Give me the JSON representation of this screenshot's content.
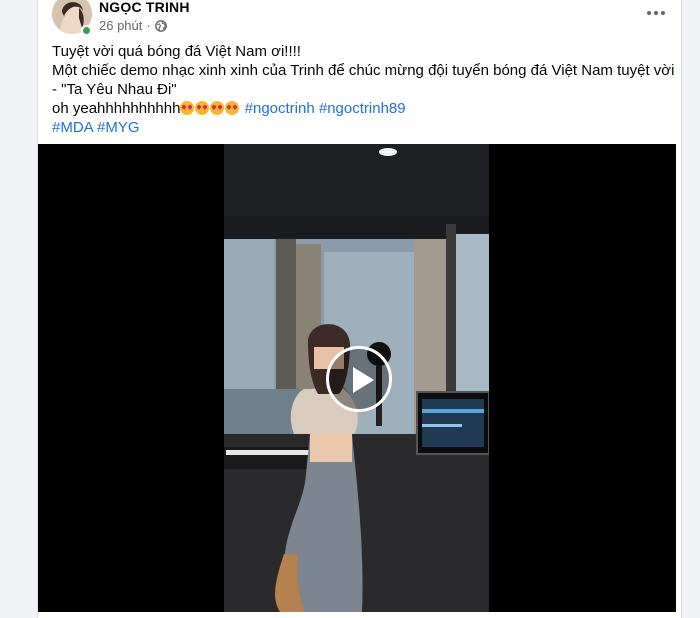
{
  "post": {
    "author": "NGỌC TRINH",
    "time": "26 phút",
    "separator": "·",
    "lines": {
      "line1": "Tuyệt vời quá bóng đá Việt Nam ơi!!!!",
      "line2": "Một chiếc demo nhạc xinh xinh của Trinh để chúc mừng đội tuyển bóng đá Việt Nam tuyệt vời",
      "line3": "- \"Ta Yêu Nhau Đi\"",
      "line4_text": "oh yeahhhhhhhhhh",
      "line4_hashtags": [
        "#ngoctrinh",
        "#ngoctrinh89"
      ],
      "line5_hashtags": [
        "#MDA",
        "#MYG"
      ]
    },
    "emojis": [
      "heart-eyes-emoji",
      "heart-eyes-emoji",
      "smiling-face-with-hearts-emoji",
      "smiling-face-with-hearts-emoji"
    ],
    "icons": {
      "privacy": "globe-icon",
      "menu": "more-options-icon",
      "video": "play-icon"
    }
  },
  "colors": {
    "hashtag": "#216fdb",
    "online": "#31a24c",
    "meta": "#65676b"
  }
}
